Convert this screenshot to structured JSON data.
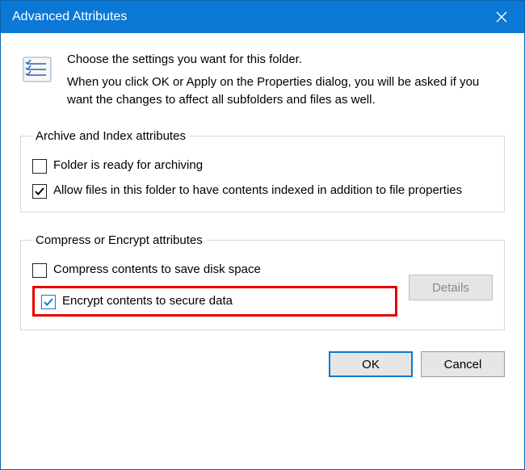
{
  "titlebar": {
    "title": "Advanced Attributes"
  },
  "intro": {
    "heading": "Choose the settings you want for this folder.",
    "body": "When you click OK or Apply on the Properties dialog, you will be asked if you want the changes to affect all subfolders and files as well."
  },
  "group1": {
    "legend": "Archive and Index attributes",
    "cb_archive": "Folder is ready for archiving",
    "cb_index": "Allow files in this folder to have contents indexed in addition to file properties"
  },
  "group2": {
    "legend": "Compress or Encrypt attributes",
    "cb_compress": "Compress contents to save disk space",
    "cb_encrypt": "Encrypt contents to secure data",
    "details_label": "Details"
  },
  "buttons": {
    "ok": "OK",
    "cancel": "Cancel"
  },
  "state": {
    "cb_archive_checked": false,
    "cb_index_checked": true,
    "cb_compress_checked": false,
    "cb_encrypt_checked": true
  }
}
